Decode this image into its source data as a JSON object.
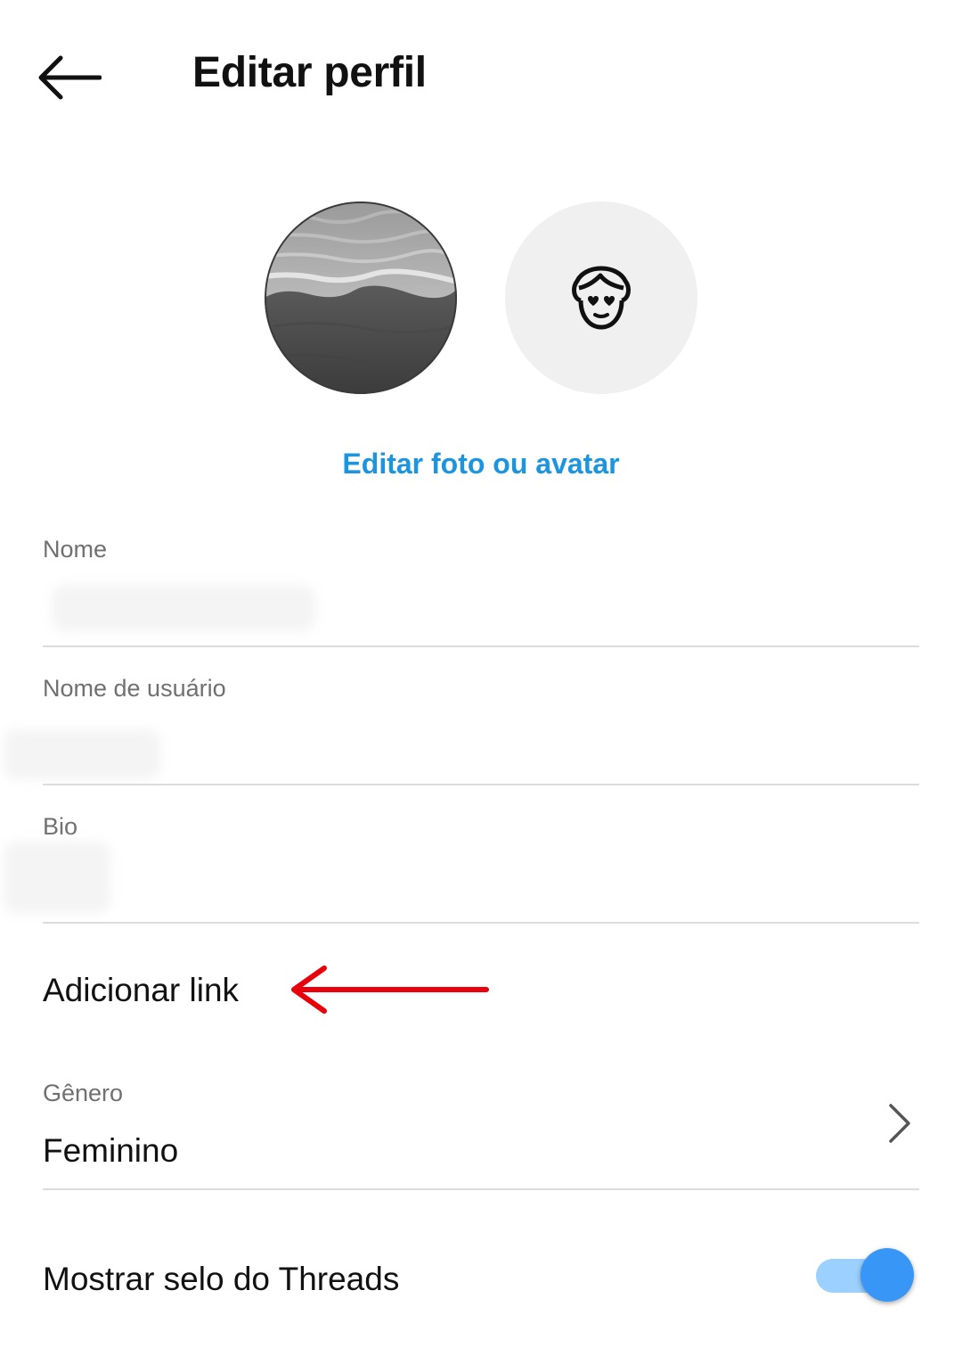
{
  "header": {
    "title": "Editar perfil",
    "back_icon": "arrow-left-icon"
  },
  "profile": {
    "photo_icon": "profile-photo",
    "avatar_icon": "avatar-face-icon",
    "edit_link": "Editar foto ou avatar",
    "accent_color": "#1b95e0"
  },
  "fields": {
    "name": {
      "label": "Nome",
      "value": ""
    },
    "username": {
      "label": "Nome de usuário",
      "value": ""
    },
    "bio": {
      "label": "Bio",
      "value": ""
    }
  },
  "add_link": {
    "label": "Adicionar link",
    "annotation_icon": "red-arrow-left-icon",
    "annotation_color": "#e8000b"
  },
  "gender": {
    "label": "Gênero",
    "value": "Feminino",
    "chevron_icon": "chevron-right-icon"
  },
  "threads_badge": {
    "label": "Mostrar selo do Threads",
    "toggle_on": true,
    "toggle_color": "#3796f6"
  }
}
